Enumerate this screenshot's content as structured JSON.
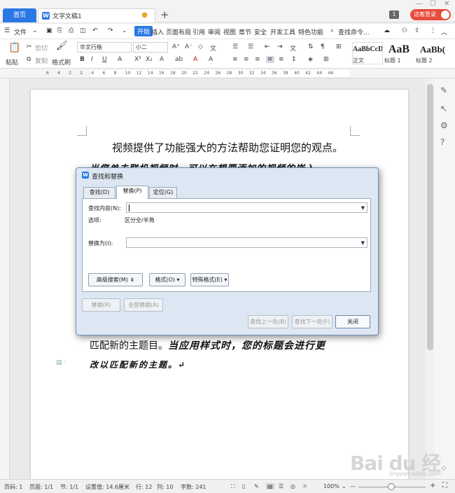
{
  "tabbar": {
    "home_label": "首页",
    "doc_tab_label": "文字文稿1",
    "doc_icon": "W",
    "new_tab": "+",
    "badge": "1",
    "login_label": "访客登录"
  },
  "menubar": {
    "items": [
      "文件",
      "开始",
      "插入",
      "页面布局",
      "引用",
      "审阅",
      "视图",
      "章节",
      "安全",
      "开发工具",
      "特色功能"
    ],
    "search": "查找命令..."
  },
  "ribbon": {
    "paste": "粘贴",
    "cut": "剪切",
    "copy": "复制",
    "format_painter": "格式刷",
    "font_name": "华文行楷",
    "font_size": "小二",
    "styles": [
      {
        "sample": "AaBbCcD",
        "label": "正文"
      },
      {
        "sample": "AaB",
        "label": "标题 1"
      },
      {
        "sample": "AaBb(",
        "label": "标题 2"
      }
    ]
  },
  "ruler": {
    "numbers": [
      "6",
      "4",
      "2",
      "2",
      "4",
      "6",
      "8",
      "10",
      "12",
      "14",
      "16",
      "18",
      "20",
      "22",
      "24",
      "26",
      "28",
      "30",
      "32",
      "34",
      "36",
      "38",
      "40",
      "42",
      "44",
      "46"
    ]
  },
  "document": {
    "line1": "视频提供了功能强大的方法帮助您证明您的观点。",
    "line2": "当您单击联机视频时，可以在想要添加的视频的嵌入",
    "line3_regular": "匹配新的主题目。",
    "line3_bold": "当应用样式时，您的标题会进行更",
    "line4": "改以匹配新的主题。↵"
  },
  "dialog": {
    "title": "查找和替换",
    "tabs": [
      "查找(D)",
      "替换(P)",
      "定位(G)"
    ],
    "find_label": "查找内容(N):",
    "find_value": "",
    "options_label": "选项:",
    "options_value": "区分全/半角",
    "replace_label": "替换为(I):",
    "replace_value": "",
    "advanced_button": "高级搜索(M) ⇟",
    "format_button": "格式(O) ▾",
    "special_button": "特殊格式(E) ▾",
    "replace_button": "替换(R)",
    "replace_all_button": "全部替换(A)",
    "find_prev_button": "查找上一处(B)",
    "find_next_button": "查找下一处(F)",
    "close_button": "关闭"
  },
  "statusbar": {
    "page_num": "页码: 1",
    "pages": "页面: 1/1",
    "section": "节: 1/1",
    "setting": "设置值: 14.6厘米",
    "row": "行: 12",
    "col": "列: 10",
    "words": "字数: 241",
    "zoom": "100%"
  },
  "watermark": {
    "text": "Bai du 经验",
    "sub": "jingyan.baidu.com"
  },
  "colors": {
    "accent": "#2b78e4",
    "login": "#e74c3c"
  }
}
